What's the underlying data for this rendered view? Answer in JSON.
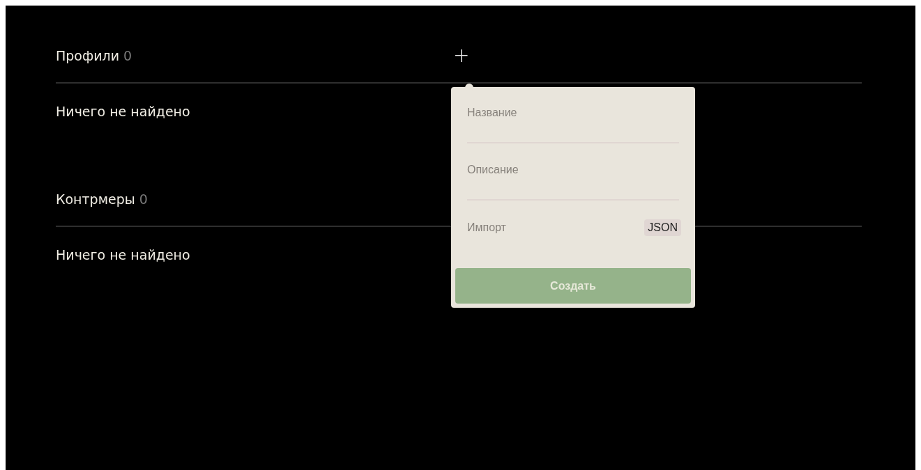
{
  "sections": [
    {
      "title": "Профили",
      "count": "0",
      "empty_text": "Ничего не найдено"
    },
    {
      "title": "Контрмеры",
      "count": "0",
      "empty_text": "Ничего не найдено"
    }
  ],
  "add_button": {
    "label": "+"
  },
  "create_popup": {
    "fields": [
      {
        "placeholder": "Название"
      },
      {
        "placeholder": "Описание"
      }
    ],
    "import": {
      "label": "Импорт",
      "format": "JSON"
    },
    "submit": "Создать"
  }
}
